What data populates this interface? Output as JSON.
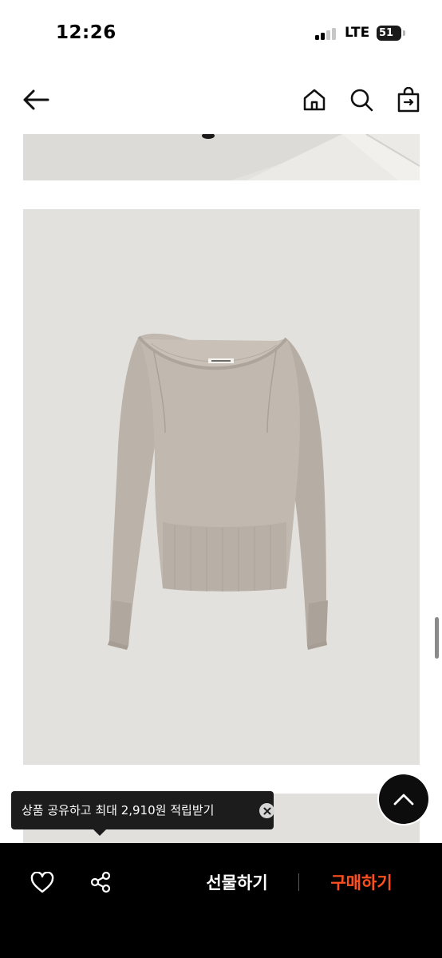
{
  "status_bar": {
    "time": "12:26",
    "network": "LTE",
    "battery_level": "51"
  },
  "nav": {
    "back_icon": "arrow-left-icon",
    "home_icon": "home-icon",
    "search_icon": "search-icon",
    "bag_icon": "shopping-bag-icon"
  },
  "tooltip": {
    "text": "상품 공유하고 최대 2,910원 적립받기",
    "close_icon": "close-circle-icon"
  },
  "scroll_top_icon": "chevron-up-icon",
  "bottom_bar": {
    "like_icon": "heart-icon",
    "share_icon": "share-icon",
    "gift_label": "선물하기",
    "buy_label": "구매하기",
    "buy_color": "#ff4f1f"
  }
}
